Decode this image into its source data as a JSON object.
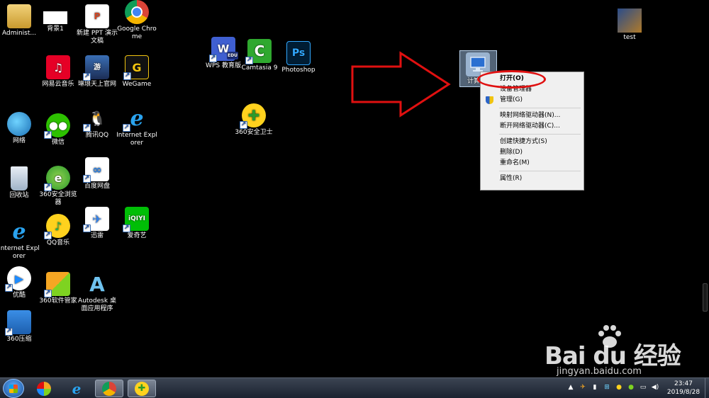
{
  "desktop_icons": {
    "administrator": {
      "label": "Administ..."
    },
    "beijing1": {
      "label": "背景1"
    },
    "new_ppt": {
      "label": "新建 PPT 演示文稿"
    },
    "chrome": {
      "label": "Google Chrome"
    },
    "netease_music": {
      "label": "网易云音乐"
    },
    "linglong": {
      "label": "琳琅天上官网"
    },
    "wegame": {
      "label": "WeGame"
    },
    "network": {
      "label": "网络"
    },
    "wechat": {
      "label": "微信"
    },
    "tencent_qq": {
      "label": "腾讯QQ"
    },
    "ie_col3": {
      "label": "Internet Explorer"
    },
    "recycle_bin": {
      "label": "回收站"
    },
    "browser_360": {
      "label": "360安全浏览器"
    },
    "baidu_disk": {
      "label": "百度网盘"
    },
    "ie_col1": {
      "label": "Internet Explorer"
    },
    "qq_music": {
      "label": "QQ音乐"
    },
    "xunlei": {
      "label": "迅雷"
    },
    "iqiyi": {
      "label": "爱奇艺"
    },
    "youku": {
      "label": "优酷"
    },
    "soft_360": {
      "label": "360软件管家"
    },
    "autodesk": {
      "label": "Autodesk 桌面应用程序"
    },
    "zip_360": {
      "label": "360压缩"
    },
    "wps": {
      "label": "WPS 教育版",
      "badge": "EDU"
    },
    "camtasia": {
      "label": "Camtasia 9"
    },
    "photoshop": {
      "label": "Photoshop",
      "glyph": "Ps"
    },
    "safe_360": {
      "label": "360安全卫士"
    },
    "test": {
      "label": "test"
    },
    "computer": {
      "label": "计算机"
    }
  },
  "context_menu": {
    "items": [
      {
        "label": "打开(O)"
      },
      {
        "label": "设备管理器"
      },
      {
        "label": "管理(G)"
      },
      {
        "label": "映射网络驱动器(N)..."
      },
      {
        "label": "断开网络驱动器(C)..."
      },
      {
        "label": "创建快捷方式(S)"
      },
      {
        "label": "删除(D)"
      },
      {
        "label": "重命名(M)"
      },
      {
        "label": "属性(R)"
      }
    ]
  },
  "annotation": {
    "color": "#e01010"
  },
  "taskbar": {
    "pinned": [
      "start-button",
      "360-panel-icon",
      "ie-icon",
      "chrome-icon",
      "360-safe-icon"
    ]
  },
  "clock": {
    "time": "23:47",
    "date": "2019/8/28"
  },
  "watermark": {
    "brand": "Bai du 经验",
    "url": "jingyan.baidu.com"
  }
}
